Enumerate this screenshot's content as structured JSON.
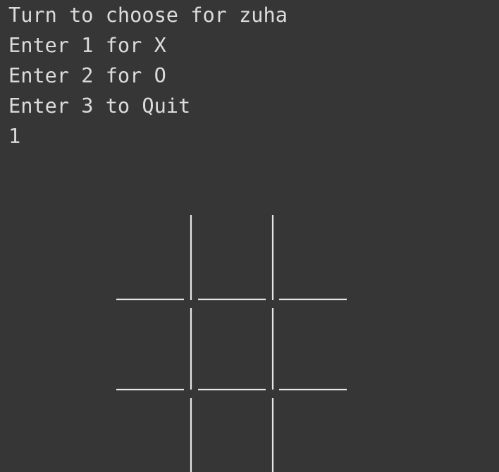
{
  "console": {
    "lines": [
      "Turn to choose for zuha",
      "Enter 1 for X",
      "Enter 2 for O",
      "Enter 3 to Quit",
      "1"
    ]
  },
  "colors": {
    "background": "#363636",
    "text": "#dcdcdc",
    "board_lines": "#e6e6e6"
  }
}
